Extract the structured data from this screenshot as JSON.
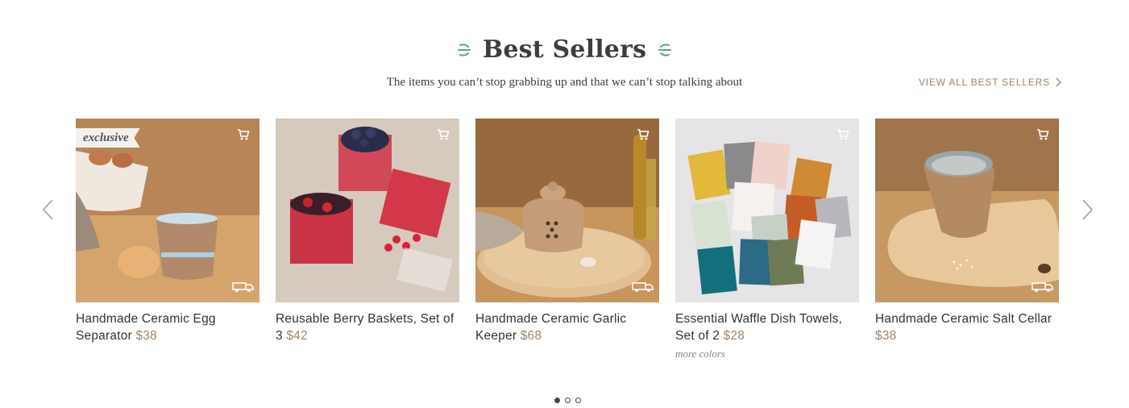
{
  "header": {
    "title": "Best Sellers",
    "subtitle": "The items you can’t stop grabbing up and that we can’t stop talking about",
    "view_all": "VIEW ALL BEST SELLERS"
  },
  "colors": {
    "accent": "#a0846a",
    "sprig": "#5aa58a",
    "title": "#3d3d3d"
  },
  "icons": {
    "cart": "cart-icon",
    "delivery": "truck-icon",
    "prev": "chevron-left-icon",
    "next": "chevron-right-icon"
  },
  "products": [
    {
      "name": "Handmade Ceramic Egg Separator",
      "price": "$38",
      "badge": "exclusive",
      "more": ""
    },
    {
      "name": "Reusable Berry Baskets, Set of 3",
      "price": "$42",
      "badge": "",
      "more": ""
    },
    {
      "name": "Handmade Ceramic Garlic Keeper",
      "price": "$68",
      "badge": "",
      "more": ""
    },
    {
      "name": "Essential Waffle Dish Towels, Set of 2",
      "price": "$28",
      "badge": "",
      "more": "more colors"
    },
    {
      "name": "Handmade Ceramic Salt Cellar",
      "price": "$38",
      "badge": "",
      "more": ""
    }
  ],
  "pagination": {
    "pages": 3,
    "current": 1
  }
}
